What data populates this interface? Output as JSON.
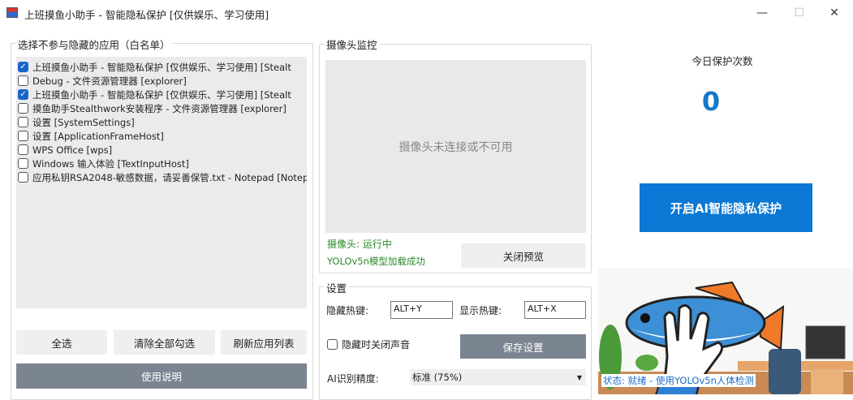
{
  "window": {
    "title": "上班摸鱼小助手 - 智能隐私保护 [仅供娱乐、学习使用]",
    "minimize": "—",
    "maximize": "☐",
    "close": "✕"
  },
  "whitelist": {
    "label": "选择不参与隐藏的应用（白名单）",
    "items": [
      {
        "label": "上班摸鱼小助手 - 智能隐私保护 [仅供娱乐、学习使用] [Stealt",
        "checked": true
      },
      {
        "label": "Debug - 文件资源管理器 [explorer]",
        "checked": false
      },
      {
        "label": "上班摸鱼小助手 - 智能隐私保护 [仅供娱乐、学习使用] [Stealt",
        "checked": true
      },
      {
        "label": "摸鱼助手Stealthwork安装程序 - 文件资源管理器 [explorer]",
        "checked": false
      },
      {
        "label": "设置 [SystemSettings]",
        "checked": false
      },
      {
        "label": "设置 [ApplicationFrameHost]",
        "checked": false
      },
      {
        "label": "WPS Office [wps]",
        "checked": false
      },
      {
        "label": "Windows 输入体验 [TextInputHost]",
        "checked": false
      },
      {
        "label": "应用私钥RSA2048-敏感数据，请妥善保管.txt - Notepad [Notep",
        "checked": false
      }
    ],
    "select_all": "全选",
    "clear_all": "清除全部勾选",
    "refresh": "刷新应用列表",
    "help": "使用说明"
  },
  "camera": {
    "label": "摄像头监控",
    "placeholder": "摄像头未连接或不可用",
    "status": "摄像头: 运行中",
    "model_status": "YOLOv5n模型加载成功",
    "close_preview": "关闭预览"
  },
  "settings": {
    "label": "设置",
    "hide_hotkey_label": "隐藏热键:",
    "hide_hotkey": "ALT+Y",
    "show_hotkey_label": "显示热键:",
    "show_hotkey": "ALT+X",
    "mute_label": "隐藏时关闭声音",
    "mute_checked": false,
    "save": "保存设置",
    "accuracy_label": "AI识别精度:",
    "accuracy_value": "标准 (75%)"
  },
  "stats": {
    "label": "今日保护次数",
    "count": "0",
    "start_button": "开启AI智能隐私保护"
  },
  "status_bar": "状态: 就绪 - 使用YOLOv5n人体检测",
  "colors": {
    "accent": "#0a78d4",
    "count": "#1577c8",
    "green": "#2a8a2a"
  }
}
